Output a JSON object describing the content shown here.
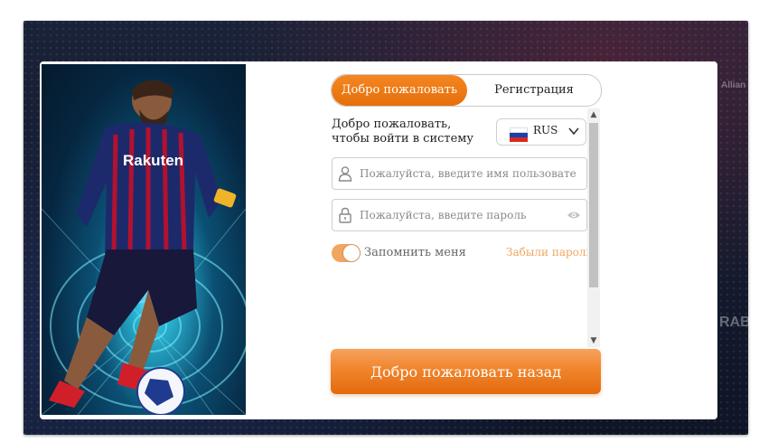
{
  "tabs": {
    "login_label": "Добро пожаловать назад",
    "register_label": "Регистрация"
  },
  "form": {
    "welcome_text": "Добро пожаловать, чтобы войти в систему",
    "language": {
      "code": "RUS",
      "flag": "russia-flag-icon"
    },
    "username": {
      "placeholder": "Пожалуйста, введите имя пользователя",
      "value": ""
    },
    "password": {
      "placeholder": "Пожалуйста, введите пароль",
      "value": ""
    },
    "remember_label": "Запомнить меня",
    "remember_checked": true,
    "forgot_label": "Забыли пароль",
    "submit_label": "Добро пожаловать назад"
  },
  "hero": {
    "shirt_text": "Rakuten"
  },
  "colors": {
    "accent": "#f0852c",
    "accent_light": "#f0a560"
  }
}
